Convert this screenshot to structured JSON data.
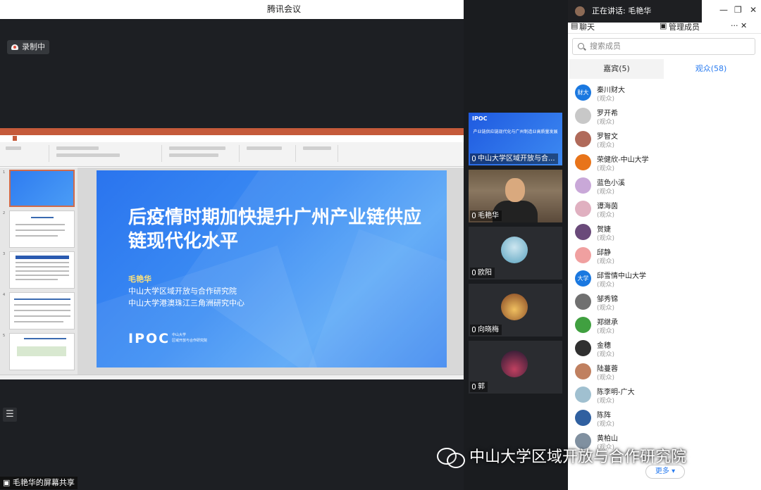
{
  "window": {
    "title": "腾讯会议"
  },
  "main": {
    "recording_label": "录制中",
    "share_label": "毛艳华的屏幕共享"
  },
  "slide": {
    "title": "后疫情时期加快提升广州产业链供应链现代化水平",
    "author": "毛艳华",
    "org_line1": "中山大学区域开放与合作研究院",
    "org_line2": "中山大学港澳珠江三角洲研究中心",
    "logo_text": "IPOC",
    "logo_sub1": "中山大学",
    "logo_sub2": "区域开放与合作研究院"
  },
  "videos": [
    {
      "name": "中山大学区域开放与合...",
      "type": "slide",
      "title_text": "产业链供应链现代化与广州制造业高质量发展",
      "logo_text": "IPOC"
    },
    {
      "name": "毛艳华",
      "type": "person"
    },
    {
      "name": "欧阳",
      "type": "avatar",
      "color": "#7fb2c9"
    },
    {
      "name": "向晓梅",
      "type": "avatar",
      "color": "#d07a2a"
    },
    {
      "name": "郭",
      "type": "avatar",
      "color": "#4a3a6a"
    }
  ],
  "panel": {
    "speaking_label": "正在讲话: 毛艳华",
    "tab_chat": "聊天",
    "tab_members": "管理成员",
    "search_placeholder": "搜索成员",
    "guests_tab": "嘉宾(5)",
    "audience_tab": "观众(58)",
    "more_button": "更多",
    "members": [
      {
        "name": "秦川财大",
        "role": "(观众)",
        "color": "#1a78e0",
        "badge": "财大"
      },
      {
        "name": "罗开希",
        "role": "(观众)",
        "color": "#c8c8c8",
        "badge": ""
      },
      {
        "name": "罗智文",
        "role": "(观众)",
        "color": "#b06a5a",
        "badge": ""
      },
      {
        "name": "荣健欣-中山大学",
        "role": "(观众)",
        "color": "#e8741a",
        "badge": ""
      },
      {
        "name": "蓝色小溪",
        "role": "(观众)",
        "color": "#c9a8d8",
        "badge": ""
      },
      {
        "name": "谭海茵",
        "role": "(观众)",
        "color": "#e0b0c0",
        "badge": ""
      },
      {
        "name": "贺婕",
        "role": "(观众)",
        "color": "#6a4a7a",
        "badge": ""
      },
      {
        "name": "邱静",
        "role": "(观众)",
        "color": "#f0a0a0",
        "badge": ""
      },
      {
        "name": "邱雪情中山大学",
        "role": "(观众)",
        "color": "#1a78e0",
        "badge": "大学"
      },
      {
        "name": "邹秀锦",
        "role": "(观众)",
        "color": "#707070",
        "badge": ""
      },
      {
        "name": "郑继承",
        "role": "(观众)",
        "color": "#40a040",
        "badge": ""
      },
      {
        "name": "金穗",
        "role": "(观众)",
        "color": "#303030",
        "badge": ""
      },
      {
        "name": "陆蔓蓉",
        "role": "(观众)",
        "color": "#c08060",
        "badge": ""
      },
      {
        "name": "陈李明-广大",
        "role": "(观众)",
        "color": "#a0c0d0",
        "badge": ""
      },
      {
        "name": "陈阵",
        "role": "(观众)",
        "color": "#3060a0",
        "badge": ""
      },
      {
        "name": "黄柏山",
        "role": "(观众)",
        "color": "#8090a0",
        "badge": ""
      }
    ]
  },
  "watermark": {
    "text": "中山大学区域开放与合作研究院"
  }
}
